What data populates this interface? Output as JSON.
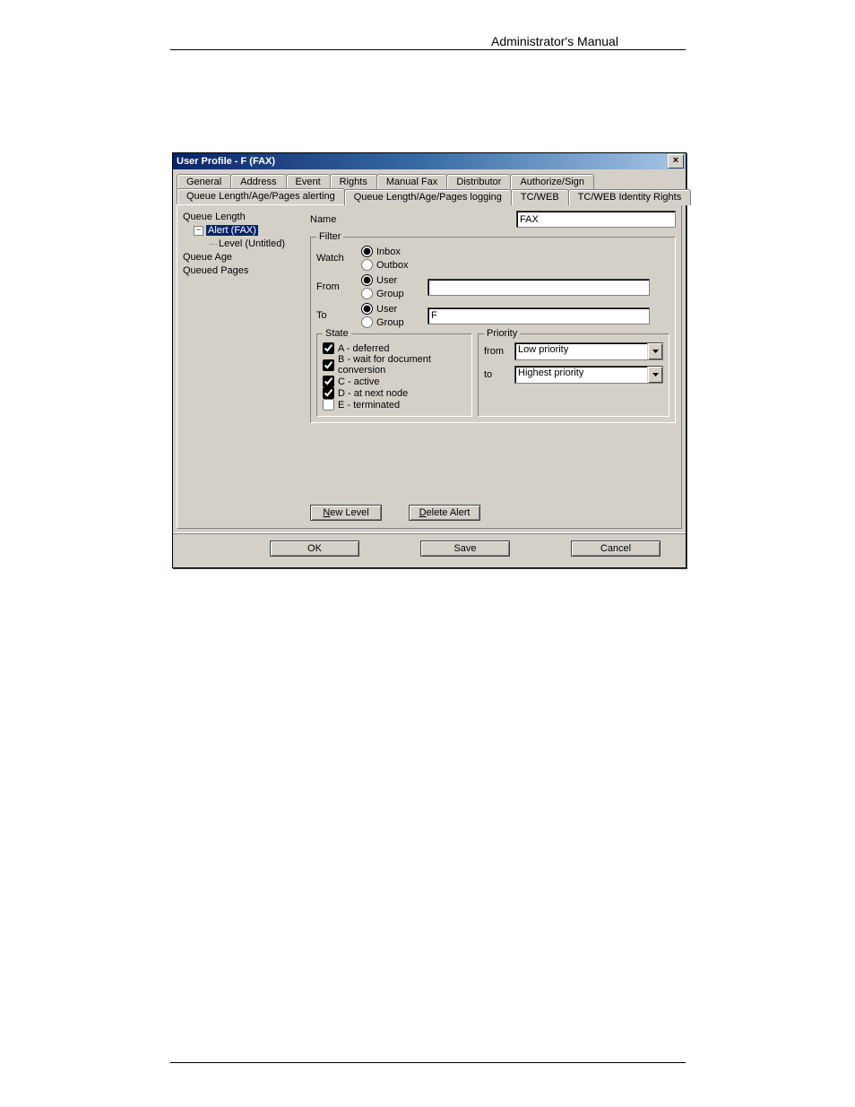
{
  "header_text": "Administrator's Manual",
  "window": {
    "title": "User Profile - F (FAX)"
  },
  "tabs_row1": [
    "General",
    "Address",
    "Event",
    "Rights",
    "Manual Fax",
    "Distributor",
    "Authorize/Sign"
  ],
  "tabs_row2": [
    "Queue Length/Age/Pages alerting",
    "Queue Length/Age/Pages logging",
    "TC/WEB",
    "TC/WEB Identity Rights"
  ],
  "active_tab": "Queue Length/Age/Pages alerting",
  "tree": {
    "n0": "Queue Length",
    "n1": "Alert (FAX)",
    "n2": "Level (Untitled)",
    "n3": "Queue Age",
    "n4": "Queued Pages"
  },
  "form": {
    "name_label": "Name",
    "name_value": "FAX",
    "filter_legend": "Filter",
    "watch_label": "Watch",
    "watch_inbox": "Inbox",
    "watch_outbox": "Outbox",
    "from_label": "From",
    "to_label": "To",
    "opt_user": "User",
    "opt_group": "Group",
    "from_value": "",
    "to_value": "F",
    "state_legend": "State",
    "state_a": "A - deferred",
    "state_b": "B - wait for document conversion",
    "state_c": "C - active",
    "state_d": "D - at next node",
    "state_e": "E - terminated",
    "priority_legend": "Priority",
    "prio_from_label": "from",
    "prio_to_label": "to",
    "prio_from_value": "Low priority",
    "prio_to_value": "Highest priority"
  },
  "buttons": {
    "new_level": "ew Level",
    "new_level_u": "N",
    "delete_alert": "elete Alert",
    "delete_alert_u": "D",
    "ok": "OK",
    "save": "Save",
    "cancel": "Cancel"
  }
}
